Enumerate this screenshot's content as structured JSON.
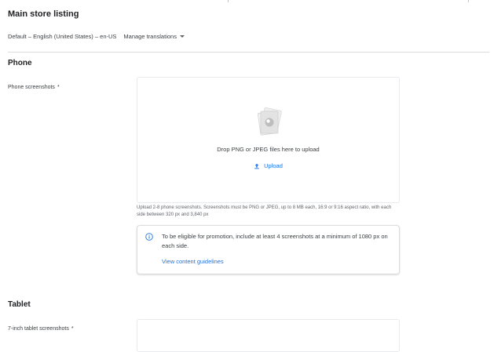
{
  "page": {
    "title": "Main store listing",
    "language": "Default – English (United States) – en-US",
    "manage_translations": "Manage translations"
  },
  "phone": {
    "heading": "Phone",
    "screenshots_label": "Phone screenshots",
    "required_mark": "*",
    "dropzone_text": "Drop PNG or JPEG files here to upload",
    "upload_label": "Upload",
    "help_text": "Upload 2-8 phone screenshots. Screenshots must be PNG or JPEG, up to 8 MB each, 16:9 or 9:16 aspect ratio, with each side between 320 px and 3,840 px",
    "info_text": "To be eligible for promotion, include at least 4 screenshots at a minimum of 1080 px on each side.",
    "info_link": "View content guidelines"
  },
  "tablet": {
    "heading": "Tablet",
    "screenshots_label": "7-inch tablet screenshots",
    "required_mark": "*"
  },
  "colors": {
    "link": "#1a73e8",
    "divider": "#dadce0",
    "text": "#202124"
  },
  "icons": {
    "dropzone": "image-stack-icon",
    "upload": "upload-icon",
    "info": "info-icon",
    "caret": "caret-down-icon"
  }
}
